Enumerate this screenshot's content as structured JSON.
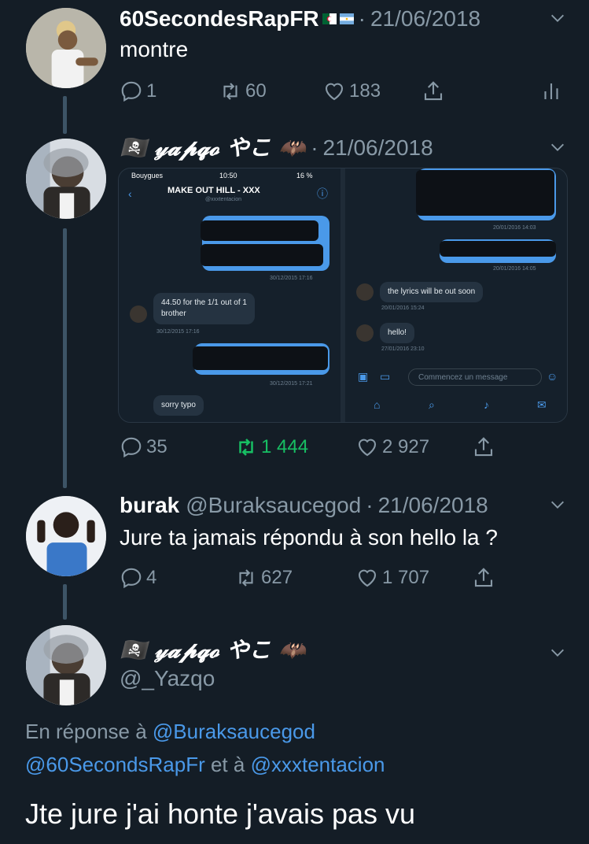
{
  "tweets": [
    {
      "name": "60SecondesRapFR",
      "date": "21/06/2018",
      "text": "montre",
      "replies": "1",
      "retweets": "60",
      "likes": "183"
    },
    {
      "name": "🏴‍☠️ 𝓎𝓪𝓹𝓺𝓸 やこ 🦇",
      "date": "21/06/2018",
      "replies": "35",
      "retweets": "1 444",
      "likes": "2 927",
      "media": {
        "carrier": "Bouygues",
        "time": "10:50",
        "battery": "16 %",
        "chat_title": "MAKE OUT HILL - XXX",
        "chat_handle": "@xxxtentacion",
        "left_messages": [
          {
            "text": "",
            "time": "30/12/2015 17:16"
          },
          {
            "text": "44.50 for the 1/1 out of 1\nbrother",
            "time": "30/12/2015 17:16"
          },
          {
            "text": "",
            "time": "30/12/2015 17:21"
          },
          {
            "text": "sorry typo",
            "time": ""
          }
        ],
        "right_messages": [
          {
            "text": "",
            "time": "20/01/2016 14:03"
          },
          {
            "text": "",
            "time": "20/01/2016 14:05"
          },
          {
            "text": "the lyrics will be out soon",
            "time": "20/01/2016 15:24"
          },
          {
            "text": "hello!",
            "time": "27/01/2016 23:10"
          }
        ],
        "compose_placeholder": "Commencez un message"
      }
    },
    {
      "name": "burak",
      "handle": "@Buraksaucegod",
      "date": "21/06/2018",
      "text": "Jure ta jamais répondu à son hello la ?",
      "replies": "4",
      "retweets": "627",
      "likes": "1 707"
    },
    {
      "name": "🏴‍☠️ 𝓎𝓪𝓹𝓺𝓸 やこ 🦇",
      "handle": "@_Yazqo",
      "reply_prefix": "En réponse à",
      "reply_user1": "@Buraksaucegod",
      "reply_user2": "@60SecondsRapFr",
      "reply_and": "et à",
      "reply_user3": "@xxxtentacion",
      "text": "Jte jure j'ai honte j'avais pas vu"
    }
  ],
  "icons": {
    "reply": "reply-icon",
    "retweet": "retweet-icon",
    "like": "heart-icon",
    "share": "share-icon",
    "analytics": "analytics-icon",
    "chevron": "chevron-down-icon"
  },
  "colors": {
    "background": "#141d26",
    "link": "#4a99e9",
    "retweet_active": "#17bf63",
    "muted": "#8899a6"
  }
}
